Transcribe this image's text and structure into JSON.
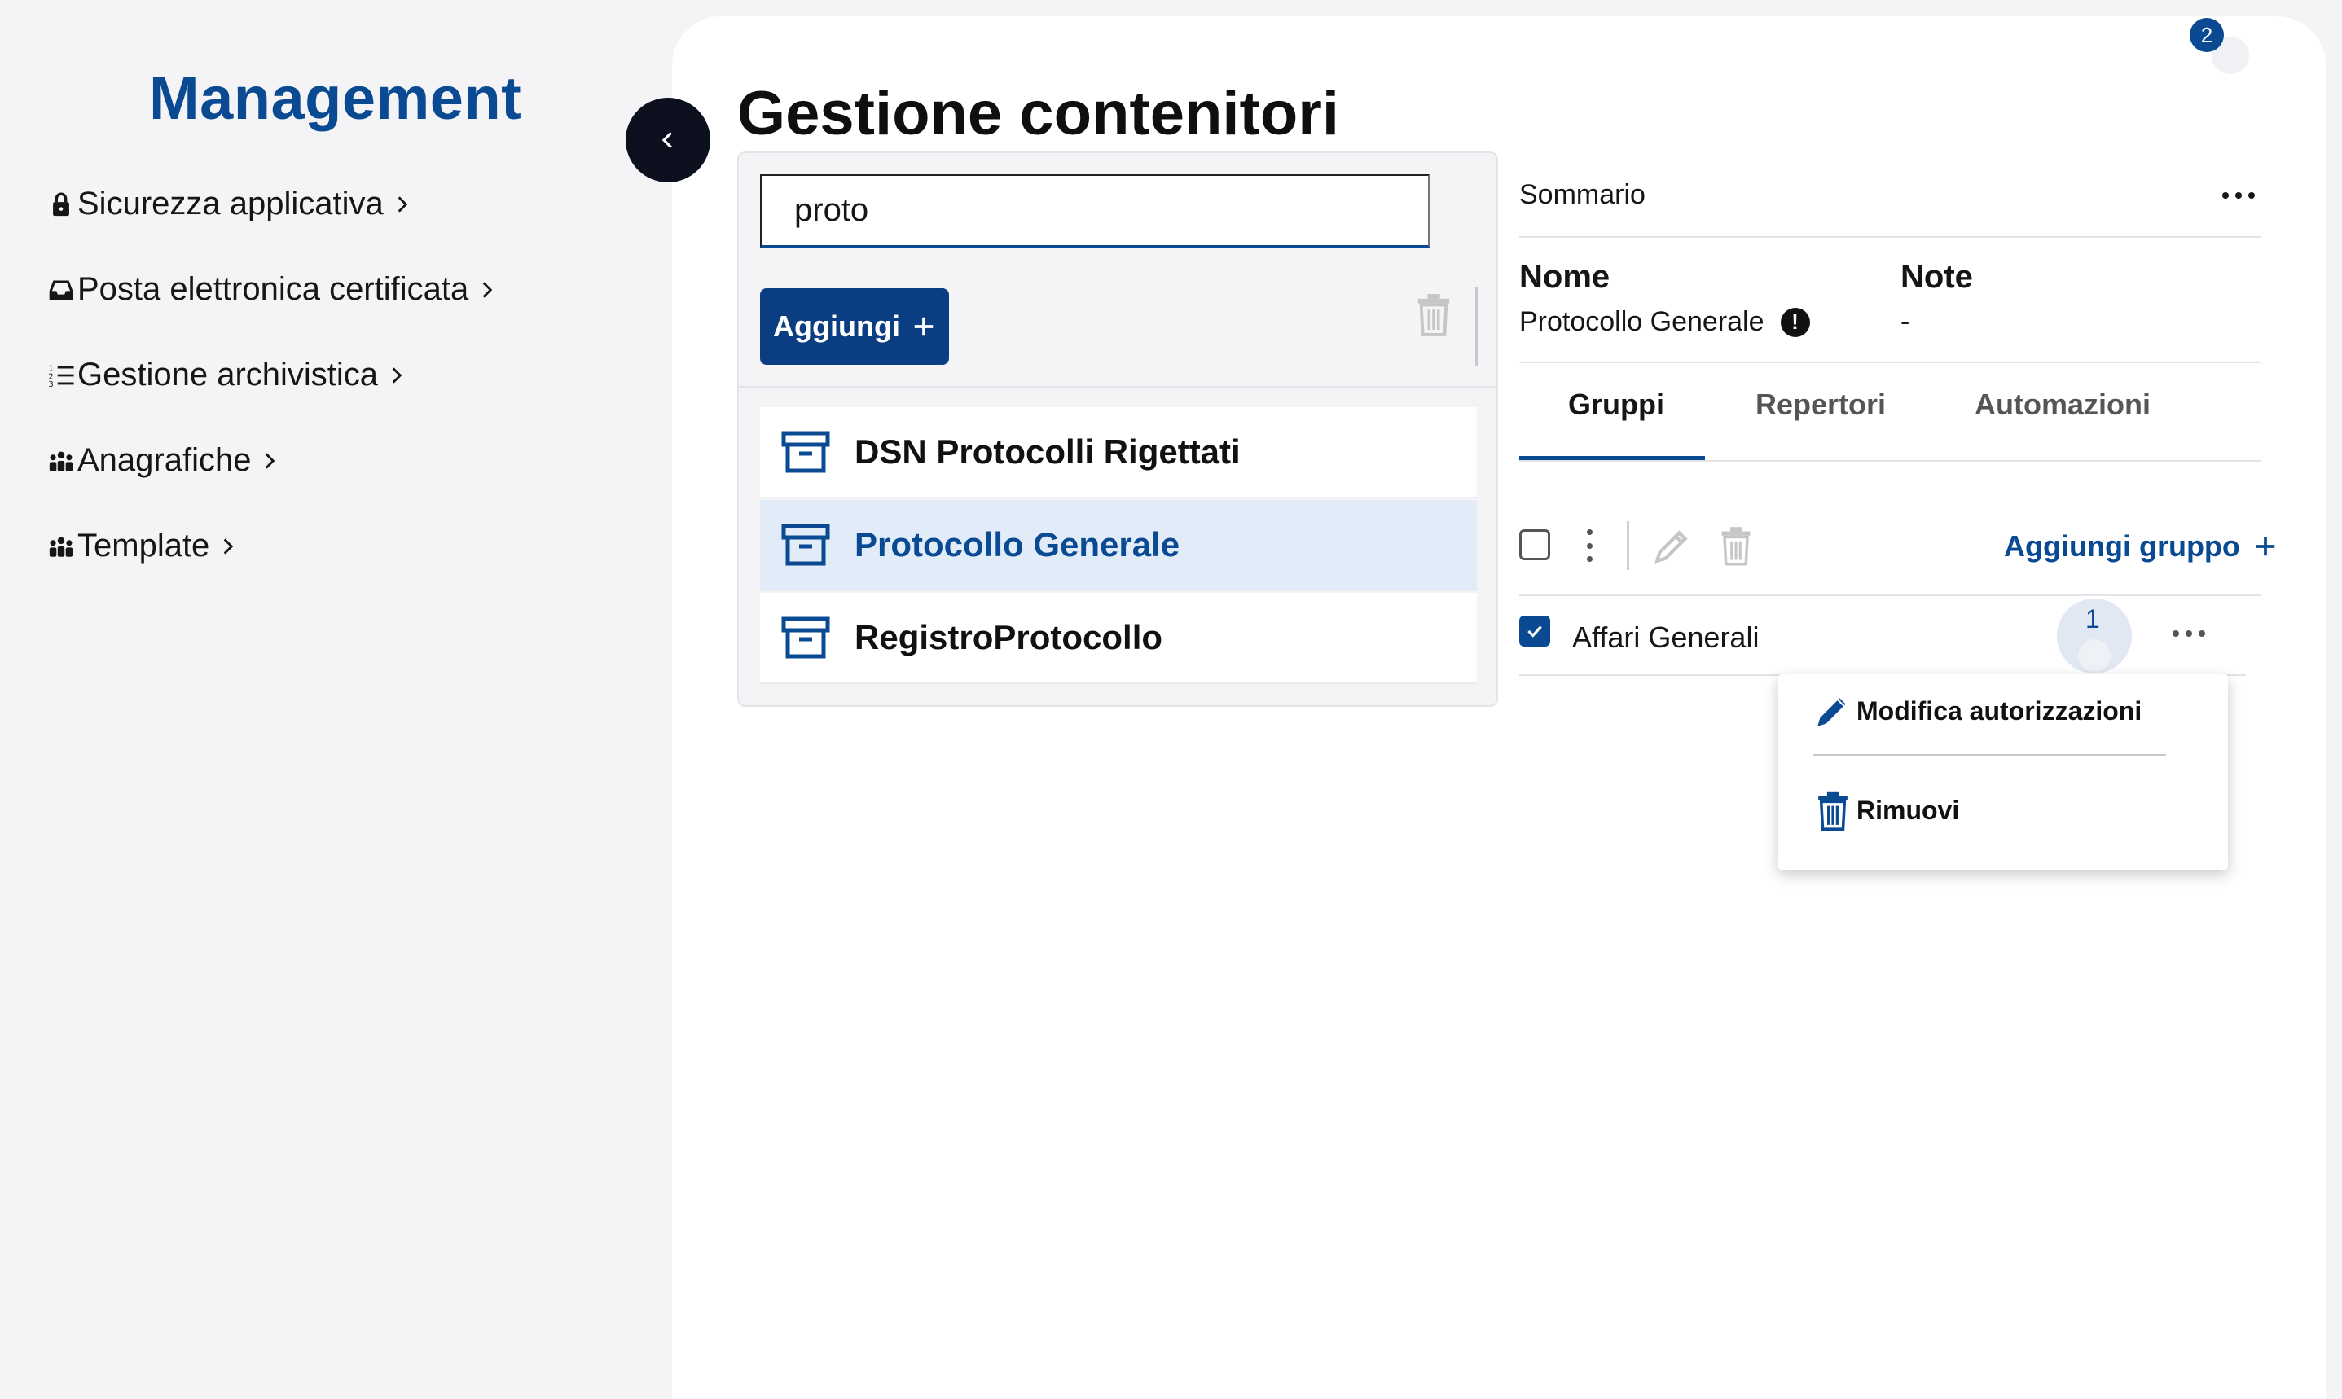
{
  "sidebar": {
    "brand": "Management",
    "items": [
      {
        "label": "Sicurezza applicativa",
        "icon": "lock-icon"
      },
      {
        "label": "Posta elettronica certificata",
        "icon": "inbox-icon"
      },
      {
        "label": "Gestione archivistica",
        "icon": "numbered-list-icon"
      },
      {
        "label": "Anagrafiche",
        "icon": "people-icon"
      },
      {
        "label": "Template",
        "icon": "people-icon"
      }
    ]
  },
  "notifications": {
    "count": "2"
  },
  "page": {
    "title": "Gestione contenitori"
  },
  "list": {
    "search_value": "proto",
    "add_label": "Aggiungi",
    "items": [
      {
        "label": "DSN Protocolli Rigettati",
        "selected": false
      },
      {
        "label": "Protocollo Generale",
        "selected": true
      },
      {
        "label": "RegistroProtocollo",
        "selected": false
      }
    ]
  },
  "detail": {
    "summary_title": "Sommario",
    "name_label": "Nome",
    "name_value": "Protocollo Generale",
    "note_label": "Note",
    "note_value": "-",
    "tabs": [
      {
        "label": "Gruppi",
        "active": true
      },
      {
        "label": "Repertori",
        "active": false
      },
      {
        "label": "Automazioni",
        "active": false
      }
    ],
    "add_group_label": "Aggiungi gruppo",
    "groups": [
      {
        "label": "Affari Generali",
        "checked": true,
        "count": "1"
      }
    ]
  },
  "context_menu": {
    "items": [
      {
        "label": "Modifica autorizzazioni",
        "icon": "pencil-icon"
      },
      {
        "label": "Rimuovi",
        "icon": "trash-icon"
      }
    ]
  },
  "colors": {
    "accent": "#0a4a93",
    "accent_dark": "#0a3d82",
    "selected_bg": "#e2ebf8"
  }
}
